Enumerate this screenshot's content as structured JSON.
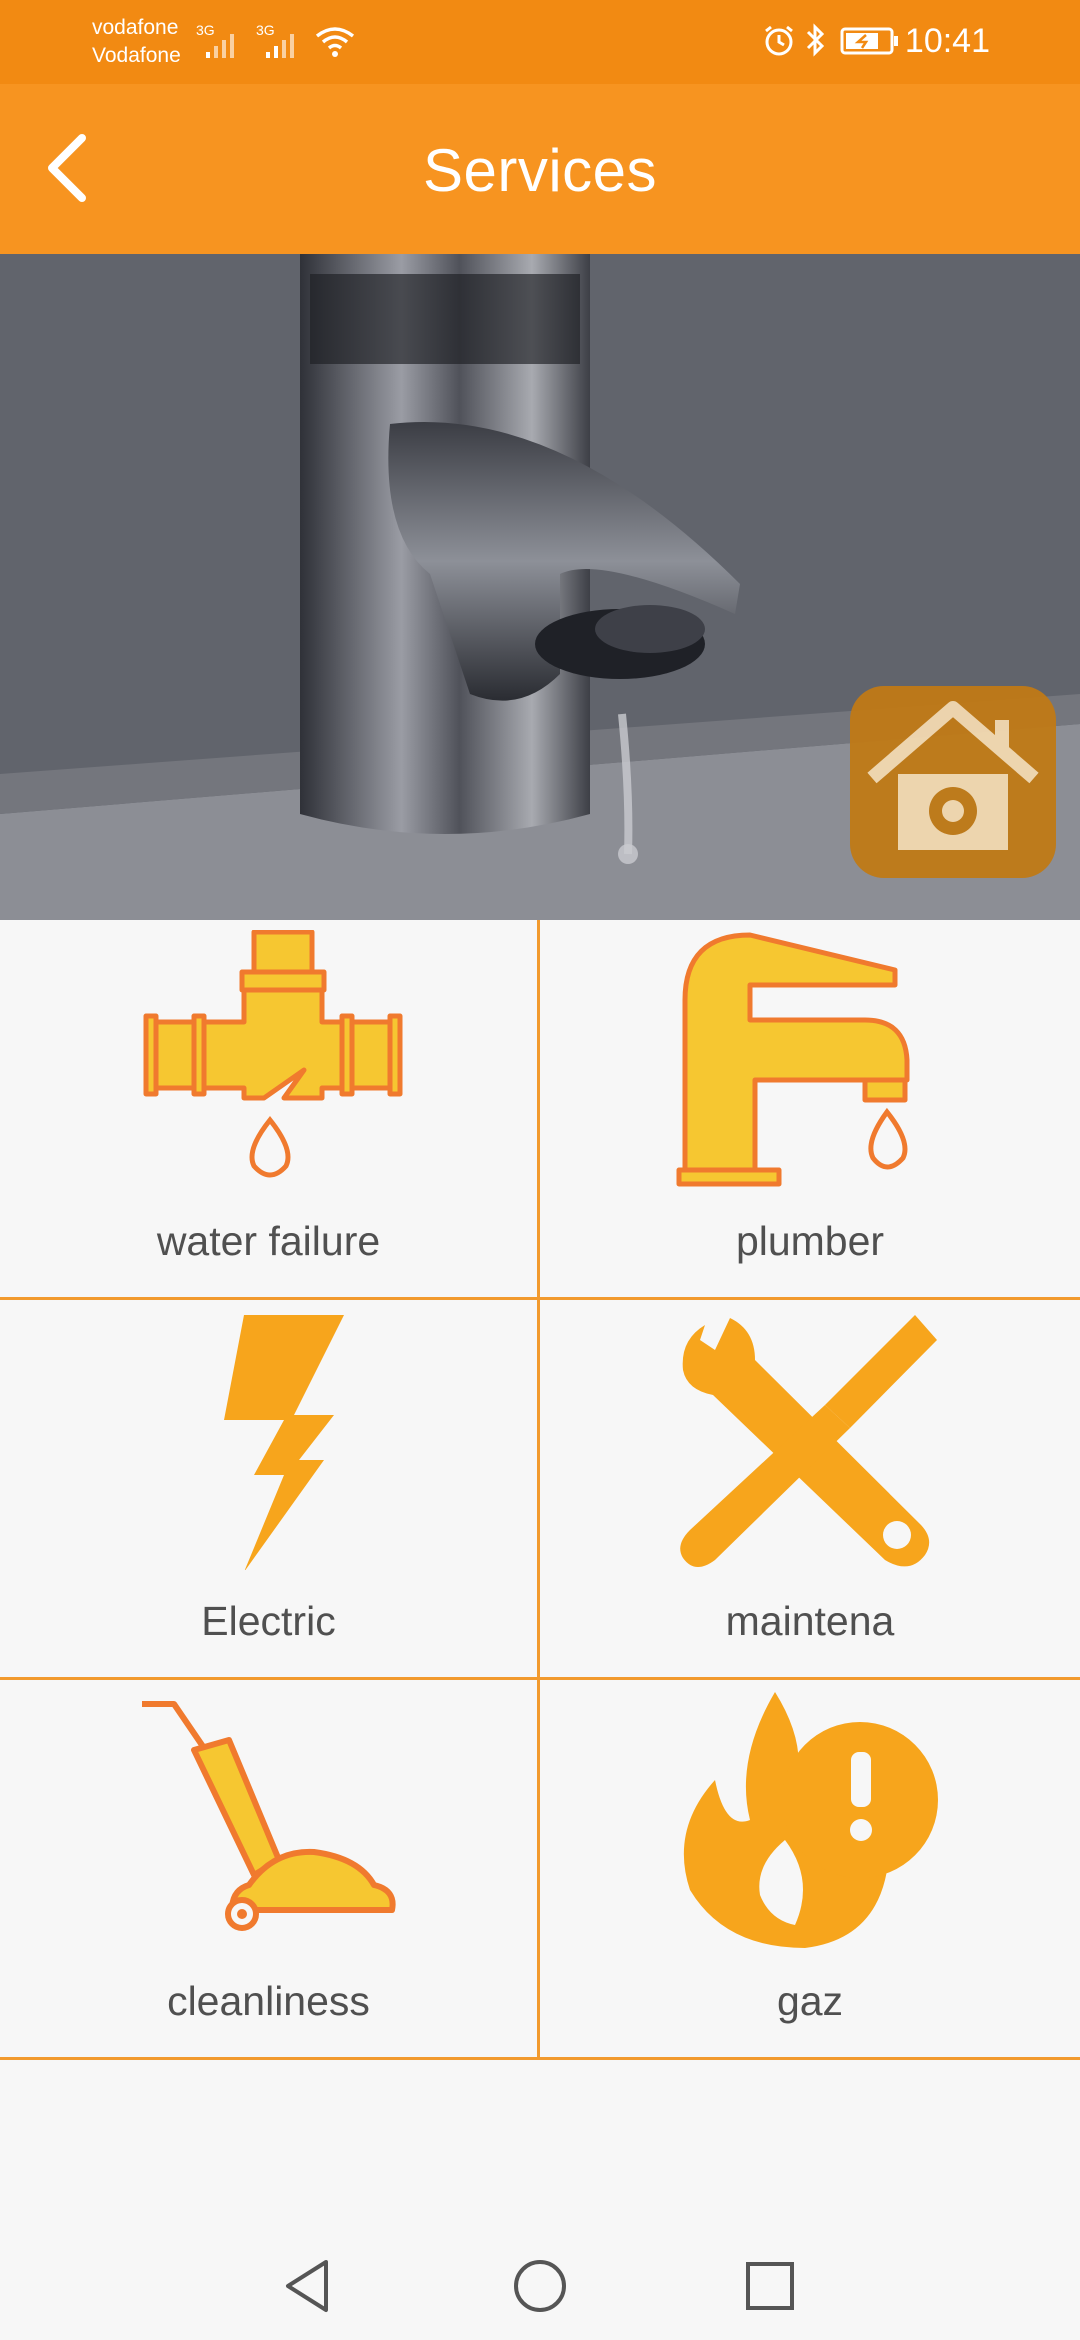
{
  "status_bar": {
    "carrier_1": "vodafone",
    "carrier_2": "Vodafone",
    "network_1": "3G",
    "network_2": "3G",
    "time": "10:41",
    "icons": [
      "signal-icon",
      "signal-icon",
      "wifi-icon",
      "alarm-icon",
      "bluetooth-icon",
      "battery-charging-icon"
    ]
  },
  "toolbar": {
    "title": "Services",
    "back_icon": "chevron-left-icon"
  },
  "hero": {
    "badge_icon": "home-gear-icon"
  },
  "services": [
    {
      "label": "water failure",
      "icon": "leaking-pipe-icon"
    },
    {
      "label": "plumber",
      "icon": "faucet-icon"
    },
    {
      "label": "Electric",
      "icon": "lightning-icon"
    },
    {
      "label": "maintena",
      "icon": "wrench-screwdriver-icon"
    },
    {
      "label": "cleanliness",
      "icon": "vacuum-icon"
    },
    {
      "label": "gaz",
      "icon": "flame-alert-icon"
    }
  ],
  "colors": {
    "status_bar": "#f28a12",
    "toolbar": "#f79420",
    "accent_icon": "#f7a51c",
    "icon_fill": "#f6c731",
    "icon_stroke": "#f07a2e",
    "divider": "#f29a2e",
    "label": "#505050"
  },
  "nav_bar": {
    "icons": [
      "back-triangle-icon",
      "home-circle-icon",
      "recents-square-icon"
    ]
  }
}
